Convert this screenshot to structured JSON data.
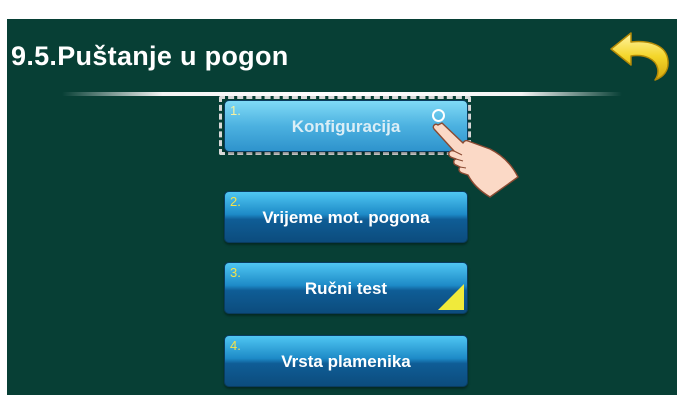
{
  "header": {
    "title": "9.5.Puštanje u pogon"
  },
  "back_button": {
    "icon": "back-arrow-icon",
    "color": "#f2d21e"
  },
  "menu": {
    "items": [
      {
        "number": "1.",
        "label": "Konfiguracija",
        "active": true
      },
      {
        "number": "2.",
        "label": "Vrijeme mot. pogona",
        "active": false
      },
      {
        "number": "3.",
        "label": "Ručni test",
        "active": false
      },
      {
        "number": "4.",
        "label": "Vrsta plamenika",
        "active": false
      }
    ]
  },
  "colors": {
    "background": "#073f35",
    "button_blue": "#1d8ac7",
    "number_yellow": "#f5e34a",
    "triangle_yellow": "#f0ea3b"
  },
  "icons": {
    "pointer": "hand-pointer-icon",
    "tap": "tap-circle-icon",
    "corner": "corner-triangle-icon"
  }
}
